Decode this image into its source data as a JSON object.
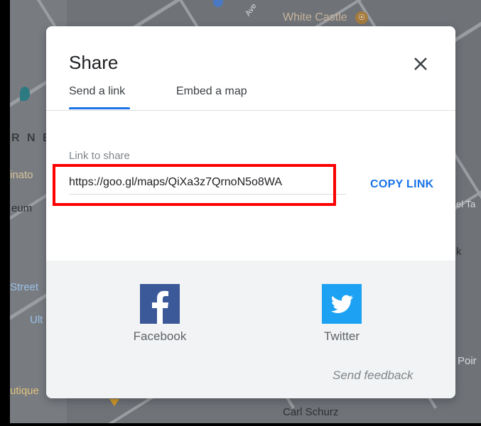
{
  "map": {
    "labels": {
      "white_castle": "White Castle",
      "rne": "R N E",
      "inato": "inato",
      "eum": "eum",
      "street": "Street",
      "ult": "Ult",
      "utique": "utique",
      "carl_schurz": "Carl Schurz",
      "el_ta": "el Ta",
      "k": "k",
      "poir": "Poir",
      "ave": "Ave"
    }
  },
  "dialog": {
    "title": "Share",
    "tabs": [
      {
        "label": "Send a link",
        "active": true
      },
      {
        "label": "Embed a map",
        "active": false
      }
    ],
    "link_label": "Link to share",
    "link_value": "https://goo.gl/maps/QiXa3z7QrnoN5o8WA",
    "copy_button": "COPY LINK",
    "social": [
      {
        "name": "Facebook",
        "icon": "facebook-icon",
        "color": "#3b5998"
      },
      {
        "name": "Twitter",
        "icon": "twitter-icon",
        "color": "#1da1f2"
      }
    ],
    "feedback": "Send feedback"
  },
  "colors": {
    "accent": "#1a73e8",
    "highlight": "#ff0000"
  }
}
